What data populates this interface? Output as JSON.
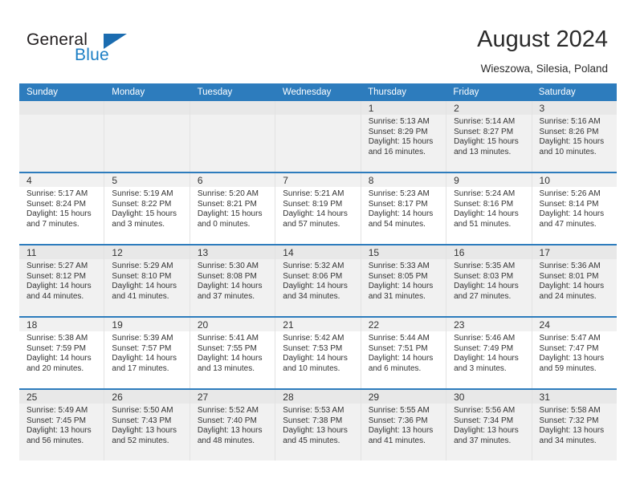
{
  "brand": {
    "name_part1": "General",
    "name_part2": "Blue",
    "triangle_color": "#1b6cb0",
    "blue_color": "#1b7ec4",
    "logo_icon": "triangle-icon"
  },
  "header": {
    "title": "August 2024",
    "location": "Wieszowa, Silesia, Poland",
    "accent_color": "#2d7cbd"
  },
  "calendar": {
    "day_headers": [
      "Sunday",
      "Monday",
      "Tuesday",
      "Wednesday",
      "Thursday",
      "Friday",
      "Saturday"
    ],
    "labels": {
      "sunrise": "Sunrise:",
      "sunset": "Sunset:",
      "daylight": "Daylight:"
    },
    "weeks": [
      [
        {
          "day": "",
          "lines": [
            "",
            "",
            "",
            ""
          ]
        },
        {
          "day": "",
          "lines": [
            "",
            "",
            "",
            ""
          ]
        },
        {
          "day": "",
          "lines": [
            "",
            "",
            "",
            ""
          ]
        },
        {
          "day": "",
          "lines": [
            "",
            "",
            "",
            ""
          ]
        },
        {
          "day": "1",
          "lines": [
            "Sunrise: 5:13 AM",
            "Sunset: 8:29 PM",
            "Daylight: 15 hours",
            "and 16 minutes."
          ]
        },
        {
          "day": "2",
          "lines": [
            "Sunrise: 5:14 AM",
            "Sunset: 8:27 PM",
            "Daylight: 15 hours",
            "and 13 minutes."
          ]
        },
        {
          "day": "3",
          "lines": [
            "Sunrise: 5:16 AM",
            "Sunset: 8:26 PM",
            "Daylight: 15 hours",
            "and 10 minutes."
          ]
        }
      ],
      [
        {
          "day": "4",
          "lines": [
            "Sunrise: 5:17 AM",
            "Sunset: 8:24 PM",
            "Daylight: 15 hours",
            "and 7 minutes."
          ]
        },
        {
          "day": "5",
          "lines": [
            "Sunrise: 5:19 AM",
            "Sunset: 8:22 PM",
            "Daylight: 15 hours",
            "and 3 minutes."
          ]
        },
        {
          "day": "6",
          "lines": [
            "Sunrise: 5:20 AM",
            "Sunset: 8:21 PM",
            "Daylight: 15 hours",
            "and 0 minutes."
          ]
        },
        {
          "day": "7",
          "lines": [
            "Sunrise: 5:21 AM",
            "Sunset: 8:19 PM",
            "Daylight: 14 hours",
            "and 57 minutes."
          ]
        },
        {
          "day": "8",
          "lines": [
            "Sunrise: 5:23 AM",
            "Sunset: 8:17 PM",
            "Daylight: 14 hours",
            "and 54 minutes."
          ]
        },
        {
          "day": "9",
          "lines": [
            "Sunrise: 5:24 AM",
            "Sunset: 8:16 PM",
            "Daylight: 14 hours",
            "and 51 minutes."
          ]
        },
        {
          "day": "10",
          "lines": [
            "Sunrise: 5:26 AM",
            "Sunset: 8:14 PM",
            "Daylight: 14 hours",
            "and 47 minutes."
          ]
        }
      ],
      [
        {
          "day": "11",
          "lines": [
            "Sunrise: 5:27 AM",
            "Sunset: 8:12 PM",
            "Daylight: 14 hours",
            "and 44 minutes."
          ]
        },
        {
          "day": "12",
          "lines": [
            "Sunrise: 5:29 AM",
            "Sunset: 8:10 PM",
            "Daylight: 14 hours",
            "and 41 minutes."
          ]
        },
        {
          "day": "13",
          "lines": [
            "Sunrise: 5:30 AM",
            "Sunset: 8:08 PM",
            "Daylight: 14 hours",
            "and 37 minutes."
          ]
        },
        {
          "day": "14",
          "lines": [
            "Sunrise: 5:32 AM",
            "Sunset: 8:06 PM",
            "Daylight: 14 hours",
            "and 34 minutes."
          ]
        },
        {
          "day": "15",
          "lines": [
            "Sunrise: 5:33 AM",
            "Sunset: 8:05 PM",
            "Daylight: 14 hours",
            "and 31 minutes."
          ]
        },
        {
          "day": "16",
          "lines": [
            "Sunrise: 5:35 AM",
            "Sunset: 8:03 PM",
            "Daylight: 14 hours",
            "and 27 minutes."
          ]
        },
        {
          "day": "17",
          "lines": [
            "Sunrise: 5:36 AM",
            "Sunset: 8:01 PM",
            "Daylight: 14 hours",
            "and 24 minutes."
          ]
        }
      ],
      [
        {
          "day": "18",
          "lines": [
            "Sunrise: 5:38 AM",
            "Sunset: 7:59 PM",
            "Daylight: 14 hours",
            "and 20 minutes."
          ]
        },
        {
          "day": "19",
          "lines": [
            "Sunrise: 5:39 AM",
            "Sunset: 7:57 PM",
            "Daylight: 14 hours",
            "and 17 minutes."
          ]
        },
        {
          "day": "20",
          "lines": [
            "Sunrise: 5:41 AM",
            "Sunset: 7:55 PM",
            "Daylight: 14 hours",
            "and 13 minutes."
          ]
        },
        {
          "day": "21",
          "lines": [
            "Sunrise: 5:42 AM",
            "Sunset: 7:53 PM",
            "Daylight: 14 hours",
            "and 10 minutes."
          ]
        },
        {
          "day": "22",
          "lines": [
            "Sunrise: 5:44 AM",
            "Sunset: 7:51 PM",
            "Daylight: 14 hours",
            "and 6 minutes."
          ]
        },
        {
          "day": "23",
          "lines": [
            "Sunrise: 5:46 AM",
            "Sunset: 7:49 PM",
            "Daylight: 14 hours",
            "and 3 minutes."
          ]
        },
        {
          "day": "24",
          "lines": [
            "Sunrise: 5:47 AM",
            "Sunset: 7:47 PM",
            "Daylight: 13 hours",
            "and 59 minutes."
          ]
        }
      ],
      [
        {
          "day": "25",
          "lines": [
            "Sunrise: 5:49 AM",
            "Sunset: 7:45 PM",
            "Daylight: 13 hours",
            "and 56 minutes."
          ]
        },
        {
          "day": "26",
          "lines": [
            "Sunrise: 5:50 AM",
            "Sunset: 7:43 PM",
            "Daylight: 13 hours",
            "and 52 minutes."
          ]
        },
        {
          "day": "27",
          "lines": [
            "Sunrise: 5:52 AM",
            "Sunset: 7:40 PM",
            "Daylight: 13 hours",
            "and 48 minutes."
          ]
        },
        {
          "day": "28",
          "lines": [
            "Sunrise: 5:53 AM",
            "Sunset: 7:38 PM",
            "Daylight: 13 hours",
            "and 45 minutes."
          ]
        },
        {
          "day": "29",
          "lines": [
            "Sunrise: 5:55 AM",
            "Sunset: 7:36 PM",
            "Daylight: 13 hours",
            "and 41 minutes."
          ]
        },
        {
          "day": "30",
          "lines": [
            "Sunrise: 5:56 AM",
            "Sunset: 7:34 PM",
            "Daylight: 13 hours",
            "and 37 minutes."
          ]
        },
        {
          "day": "31",
          "lines": [
            "Sunrise: 5:58 AM",
            "Sunset: 7:32 PM",
            "Daylight: 13 hours",
            "and 34 minutes."
          ]
        }
      ]
    ]
  }
}
